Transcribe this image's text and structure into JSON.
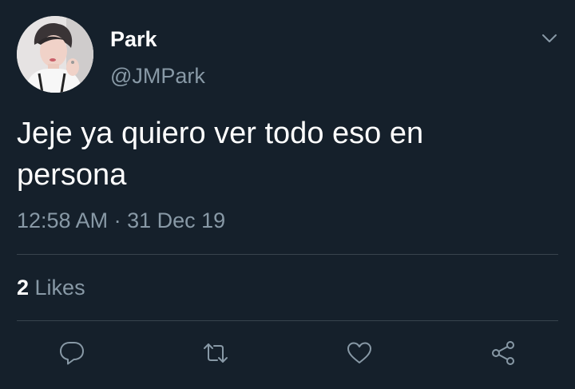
{
  "tweet": {
    "author": {
      "display_name": "Park",
      "handle": "@JMPark",
      "avatar_icon": "profile-photo"
    },
    "text": "Jeje ya quiero ver todo eso en persona",
    "time": "12:58 AM",
    "separator": " · ",
    "date": "31 Dec 19",
    "stats": {
      "likes_count": "2",
      "likes_label": " Likes"
    },
    "actions": [
      {
        "name": "reply",
        "icon": "comment-icon"
      },
      {
        "name": "retweet",
        "icon": "retweet-icon"
      },
      {
        "name": "like",
        "icon": "heart-icon"
      },
      {
        "name": "share",
        "icon": "share-icon"
      }
    ]
  },
  "colors": {
    "background": "#15202b",
    "primary_text": "#ffffff",
    "secondary_text": "#8899a6",
    "divider": "#38444d"
  }
}
